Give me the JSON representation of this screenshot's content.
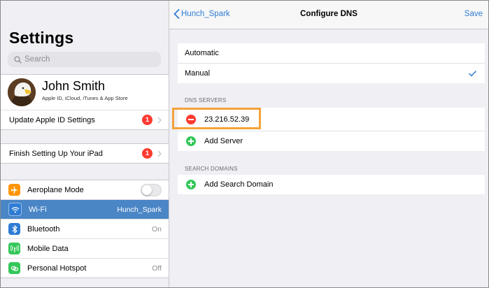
{
  "sidebar": {
    "title": "Settings",
    "search_placeholder": "Search",
    "profile": {
      "name": "John Smith",
      "subtitle": "Apple ID, iCloud, iTunes & App Store"
    },
    "update_row": {
      "label": "Update Apple ID Settings",
      "badge": "1"
    },
    "finish_row": {
      "label": "Finish Setting Up Your iPad",
      "badge": "1"
    },
    "items": [
      {
        "label": "Aeroplane Mode",
        "value": "",
        "icon": "airplane-icon",
        "color": "#ff9500"
      },
      {
        "label": "Wi-Fi",
        "value": "Hunch_Spark",
        "icon": "wifi-icon",
        "color": "#2f7cd4"
      },
      {
        "label": "Bluetooth",
        "value": "On",
        "icon": "bluetooth-icon",
        "color": "#2f7cd4"
      },
      {
        "label": "Mobile Data",
        "value": "",
        "icon": "antenna-icon",
        "color": "#34c759"
      },
      {
        "label": "Personal Hotspot",
        "value": "Off",
        "icon": "hotspot-icon",
        "color": "#34c759"
      }
    ]
  },
  "nav": {
    "back_label": "Hunch_Spark",
    "title": "Configure DNS",
    "save_label": "Save"
  },
  "dns_mode": {
    "options": [
      "Automatic",
      "Manual"
    ],
    "selected": "Manual"
  },
  "dns_servers": {
    "header": "DNS SERVERS",
    "servers": [
      "23.216.52.39"
    ],
    "add_label": "Add Server"
  },
  "search_domains": {
    "header": "SEARCH DOMAINS",
    "add_label": "Add Search Domain"
  },
  "colors": {
    "accent": "#2f7cd4",
    "selected_row": "#4a86c6",
    "badge_red": "#ff3b30",
    "add_green": "#34c759",
    "highlight_orange": "#f4a23a"
  }
}
